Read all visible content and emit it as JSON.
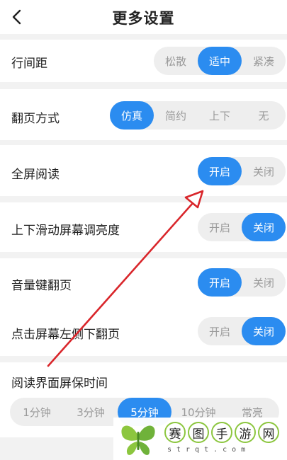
{
  "header": {
    "title": "更多设置",
    "back_icon": "chevron-left-icon"
  },
  "settings": {
    "line_spacing": {
      "label": "行间距",
      "options": [
        "松散",
        "适中",
        "紧凑"
      ],
      "selected": "适中"
    },
    "page_turn": {
      "label": "翻页方式",
      "options": [
        "仿真",
        "简约",
        "上下",
        "无"
      ],
      "selected": "仿真"
    },
    "fullscreen": {
      "label": "全屏阅读",
      "options": [
        "开启",
        "关闭"
      ],
      "selected": "开启"
    },
    "swipe_brightness": {
      "label": "上下滑动屏幕调亮度",
      "options": [
        "开启",
        "关闭"
      ],
      "selected": "关闭"
    },
    "volume_key": {
      "label": "音量键翻页",
      "options": [
        "开启",
        "关闭"
      ],
      "selected": "开启"
    },
    "tap_left": {
      "label": "点击屏幕左侧下翻页",
      "options": [
        "开启",
        "关闭"
      ],
      "selected": "关闭"
    },
    "screensaver": {
      "label": "阅读界面屏保时间",
      "options": [
        "1分钟",
        "3分钟",
        "5分钟",
        "10分钟",
        "常亮"
      ],
      "selected": "5分钟"
    }
  },
  "watermark": {
    "chars": [
      "赛",
      "图",
      "手",
      "游",
      "网"
    ],
    "url": "strqt.com"
  },
  "colors": {
    "accent": "#2b8cf0",
    "annotation": "#d9262b",
    "background": "#f2f2f2"
  }
}
